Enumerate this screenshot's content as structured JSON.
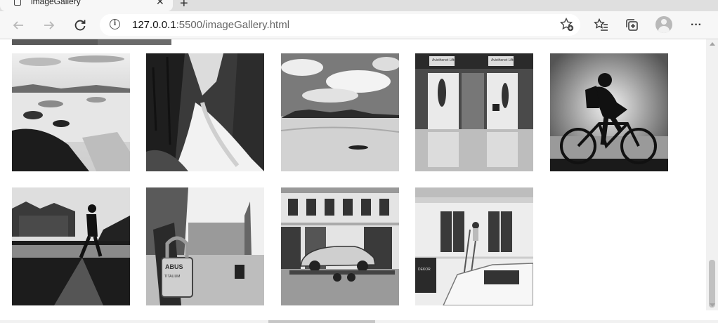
{
  "tab": {
    "title": "imageGallery",
    "close_glyph": "✕",
    "new_tab_glyph": "+"
  },
  "toolbar": {
    "back_icon": "back-arrow-icon",
    "forward_icon": "forward-arrow-icon",
    "refresh_icon": "refresh-icon",
    "info_icon": "info-icon",
    "favorite_icon": "star-add-icon",
    "favorites_icon": "favorites-icon",
    "collections_icon": "collections-icon",
    "menu_glyph": "···"
  },
  "address": {
    "host": "127.0.0.1",
    "path": ":5500/imageGallery.html"
  },
  "gallery": {
    "photos": [
      "coastal-ice-landscape",
      "forest-waterfall",
      "desert-dunes-clouds",
      "airport-elevators-travellers",
      "cyclist-silhouette",
      "walker-silhouette-city",
      "padlock-on-post",
      "vintage-car-on-trailer",
      "painter-on-ladder-building"
    ],
    "elevator_sign_left": "Avisthenet Lifts",
    "elevator_sign_right": "Avisthenet Lifts",
    "lock_brand": "ABUS",
    "lock_model": "TITALIUM",
    "van_door_text": "DEKOR"
  },
  "colors": {
    "tab_strip": "#dfdfdf",
    "toolbar": "#f7f7f7",
    "page_background": "#ffffff"
  }
}
